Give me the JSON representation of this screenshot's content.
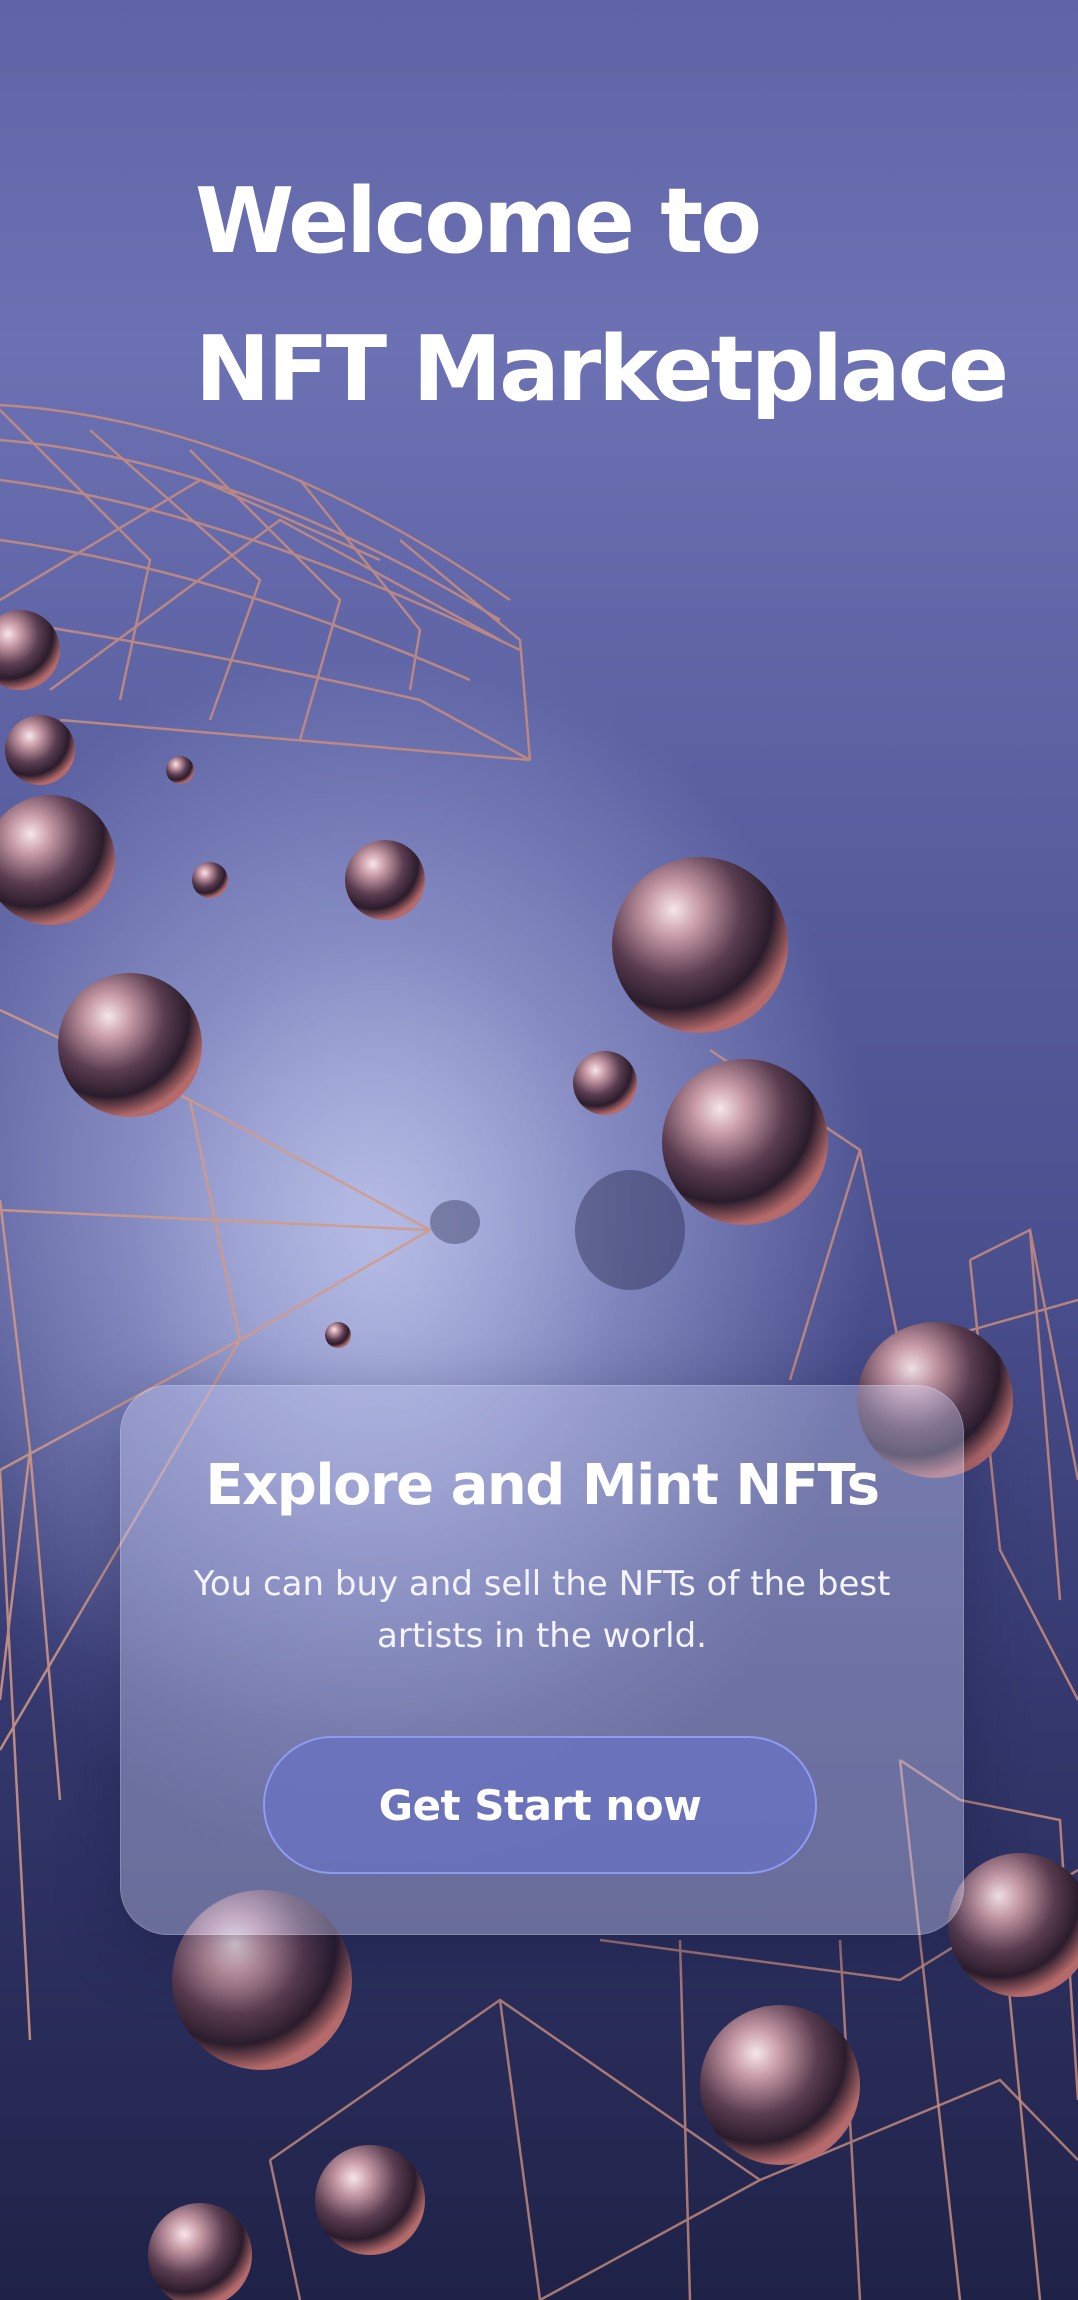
{
  "hero": {
    "line1": "Welcome to",
    "line2": "NFT Marketplace"
  },
  "card": {
    "title": "Explore and Mint NFTs",
    "body": "You can buy and sell the NFTs of the best artists in the world.",
    "button_label": "Get Start now"
  },
  "colors": {
    "background_top": "#5f64a6",
    "background_bottom": "#1f2247",
    "accent_border": "#8f9bf2",
    "button_fill": "#6872be",
    "wire": "#c98d7e"
  }
}
